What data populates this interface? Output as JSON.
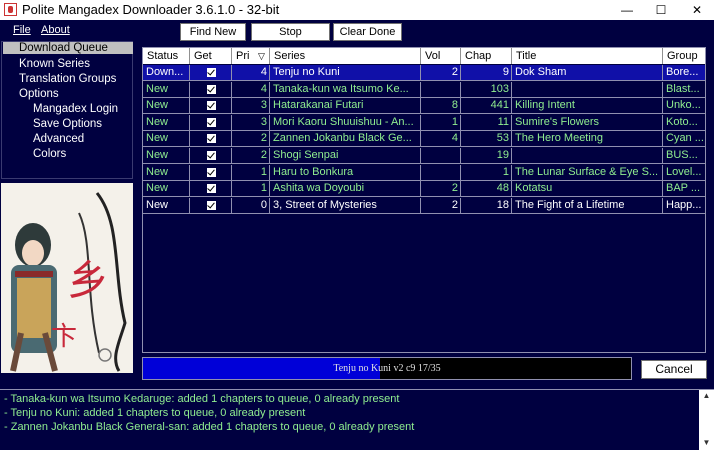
{
  "window": {
    "title": "Polite Mangadex Downloader 3.6.1.0 - 32-bit",
    "min": "—",
    "max": "☐",
    "close": "✕"
  },
  "menu": {
    "file": "File",
    "about": "About"
  },
  "toolbar": {
    "find_new": "Find New",
    "stop": "Stop",
    "clear_done": "Clear Done"
  },
  "nav": {
    "download_queue": "Download Queue",
    "known_series": "Known Series",
    "translation_groups": "Translation Groups",
    "options": "Options",
    "mangadex_login": "Mangadex Login",
    "save_options": "Save Options",
    "advanced": "Advanced",
    "colors": "Colors"
  },
  "table": {
    "headers": {
      "status": "Status",
      "get": "Get",
      "pri": "Pri",
      "sort_icon": "▽",
      "series": "Series",
      "vol": "Vol",
      "chap": "Chap",
      "title": "Title",
      "group": "Group"
    },
    "rows": [
      {
        "status": "Down...",
        "pri": "4",
        "series": "Tenju no Kuni",
        "vol": "2",
        "chap": "9",
        "title": "Dok Sham",
        "group": "Bore..."
      },
      {
        "status": "New",
        "pri": "4",
        "series": "Tanaka-kun wa Itsumo Ke...",
        "vol": "",
        "chap": "103",
        "title": "",
        "group": "Blast..."
      },
      {
        "status": "New",
        "pri": "3",
        "series": "Hatarakanai Futari",
        "vol": "8",
        "chap": "441",
        "title": "Killing Intent",
        "group": "Unko..."
      },
      {
        "status": "New",
        "pri": "3",
        "series": "Mori Kaoru Shuuishuu - An...",
        "vol": "1",
        "chap": "11",
        "title": "Sumire's Flowers",
        "group": "Koto..."
      },
      {
        "status": "New",
        "pri": "2",
        "series": "Zannen Jokanbu Black Ge...",
        "vol": "4",
        "chap": "53",
        "title": "The Hero Meeting",
        "group": "Cyan ..."
      },
      {
        "status": "New",
        "pri": "2",
        "series": "Shogi Senpai",
        "vol": "",
        "chap": "19",
        "title": "",
        "group": "BUS..."
      },
      {
        "status": "New",
        "pri": "1",
        "series": "Haru to Bonkura",
        "vol": "",
        "chap": "1",
        "title": "The Lunar Surface & Eye S...",
        "group": "Lovel..."
      },
      {
        "status": "New",
        "pri": "1",
        "series": "Ashita wa Doyoubi",
        "vol": "2",
        "chap": "48",
        "title": "Kotatsu",
        "group": "BAP ..."
      },
      {
        "status": "New",
        "pri": "0",
        "series": "3, Street of Mysteries",
        "vol": "2",
        "chap": "18",
        "title": "The Fight of a Lifetime",
        "group": "Happ..."
      }
    ]
  },
  "progress": {
    "text": "Tenju no Kuni v2 c9 17/35",
    "fraction": 0.4857,
    "color": "#0000d8"
  },
  "cancel": "Cancel",
  "log": [
    "- Tanaka-kun wa Itsumo Kedaruge: added 1 chapters to queue, 0 already present",
    "- Tenju no Kuni: added 1 chapters to queue, 0 already present",
    "- Zannen Jokanbu Black General-san: added 1 chapters to queue, 0 already present"
  ],
  "scroll": {
    "up": "▲",
    "down": "▼"
  },
  "colors": {
    "background": "#000040",
    "new_text": "#90ee90",
    "selected_row": "#1010a8"
  }
}
